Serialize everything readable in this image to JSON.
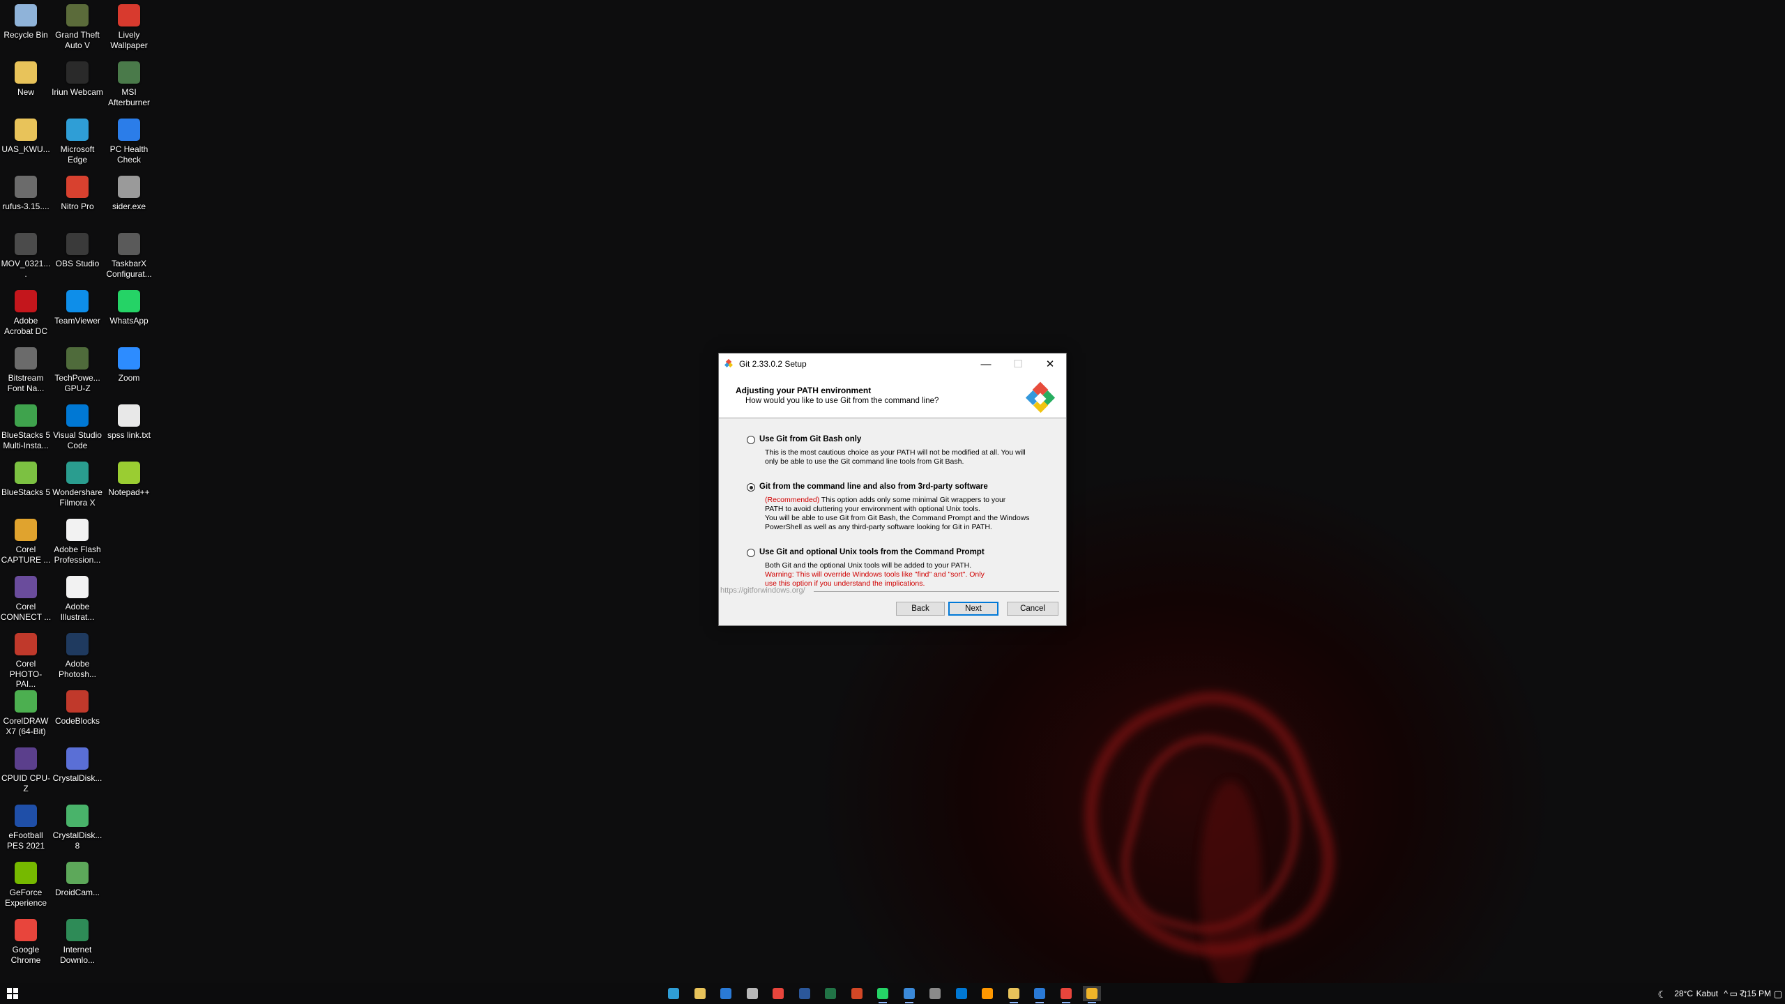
{
  "desktop": {
    "icons": [
      {
        "label": "Recycle Bin",
        "icon": "recycle-bin-icon",
        "color": "#8fb3d9"
      },
      {
        "label": "Grand Theft Auto V",
        "icon": "gta-icon",
        "color": "#5b6b3a"
      },
      {
        "label": "Lively Wallpaper",
        "icon": "lively-icon",
        "color": "#d83a2e"
      },
      {
        "label": "New",
        "icon": "folder-icon",
        "color": "#e8c35a"
      },
      {
        "label": "Iriun Webcam",
        "icon": "webcam-icon",
        "color": "#2a2a2a"
      },
      {
        "label": "MSI Afterburner",
        "icon": "afterburner-icon",
        "color": "#4a7a4a"
      },
      {
        "label": "UAS_KWU...",
        "icon": "folder-icon",
        "color": "#e8c35a"
      },
      {
        "label": "Microsoft Edge",
        "icon": "edge-icon",
        "color": "#2f9ed6"
      },
      {
        "label": "PC Health Check",
        "icon": "health-icon",
        "color": "#2b7de9"
      },
      {
        "label": "rufus-3.15....",
        "icon": "usb-icon",
        "color": "#6b6b6b"
      },
      {
        "label": "Nitro Pro",
        "icon": "nitro-icon",
        "color": "#d8412f"
      },
      {
        "label": "sider.exe",
        "icon": "exe-icon",
        "color": "#9a9a9a"
      },
      {
        "label": "MOV_0321....",
        "icon": "video-icon",
        "color": "#4b4b4b"
      },
      {
        "label": "OBS Studio",
        "icon": "obs-icon",
        "color": "#3a3a3a"
      },
      {
        "label": "TaskbarX Configurat...",
        "icon": "taskbarx-icon",
        "color": "#5a5a5a"
      },
      {
        "label": "Adobe Acrobat DC",
        "icon": "acrobat-icon",
        "color": "#c4161c"
      },
      {
        "label": "TeamViewer",
        "icon": "teamviewer-icon",
        "color": "#0e8ee9"
      },
      {
        "label": "WhatsApp",
        "icon": "whatsapp-icon",
        "color": "#25d366"
      },
      {
        "label": "Bitstream Font Na...",
        "icon": "font-icon",
        "color": "#6b6b6b"
      },
      {
        "label": "TechPowe... GPU-Z",
        "icon": "gpuz-icon",
        "color": "#4f6b3b"
      },
      {
        "label": "Zoom",
        "icon": "zoom-icon",
        "color": "#2d8cff"
      },
      {
        "label": "BlueStacks 5 Multi-Insta...",
        "icon": "bluestacks-multi-icon",
        "color": "#3fa34d"
      },
      {
        "label": "Visual Studio Code",
        "icon": "vscode-icon",
        "color": "#0078d4"
      },
      {
        "label": "spss link.txt",
        "icon": "text-file-icon",
        "color": "#e8e8e8"
      },
      {
        "label": "BlueStacks 5",
        "icon": "bluestacks-icon",
        "color": "#7cc142"
      },
      {
        "label": "Wondershare Filmora X",
        "icon": "filmora-icon",
        "color": "#2a9d8f"
      },
      {
        "label": "Notepad++",
        "icon": "notepadpp-icon",
        "color": "#9acd32"
      },
      {
        "label": "Corel CAPTURE ...",
        "icon": "corel-capture-icon",
        "color": "#e0a32e"
      },
      {
        "label": "Adobe Flash Profession...",
        "icon": "file-icon",
        "color": "#f2f2f2"
      },
      {
        "label": "Corel CONNECT ...",
        "icon": "corel-connect-icon",
        "color": "#6a4c9c"
      },
      {
        "label": "Adobe Illustrat...",
        "icon": "file-icon",
        "color": "#f2f2f2"
      },
      {
        "label": "Corel PHOTO-PAI...",
        "icon": "corel-photopaint-icon",
        "color": "#c0392b"
      },
      {
        "label": "Adobe Photosh...",
        "icon": "photoshop-icon",
        "color": "#1f3a5f"
      },
      {
        "label": "CorelDRAW X7 (64-Bit)",
        "icon": "coreldraw-icon",
        "color": "#4caf50"
      },
      {
        "label": "CodeBlocks",
        "icon": "codeblocks-icon",
        "color": "#c0392b"
      },
      {
        "label": "CPUID CPU-Z",
        "icon": "cpuz-icon",
        "color": "#5b3f8c"
      },
      {
        "label": "CrystalDisk...",
        "icon": "crystaldisk-icon",
        "color": "#5a6fd6"
      },
      {
        "label": "eFootball PES 2021",
        "icon": "pes-icon",
        "color": "#1f4fa8"
      },
      {
        "label": "CrystalDisk... 8",
        "icon": "crystaldisk-icon",
        "color": "#49b36a"
      },
      {
        "label": "GeForce Experience",
        "icon": "geforce-icon",
        "color": "#76b900"
      },
      {
        "label": "DroidCam...",
        "icon": "droidcam-icon",
        "color": "#5da85a"
      },
      {
        "label": "Google Chrome",
        "icon": "chrome-icon",
        "color": "#e8453c"
      },
      {
        "label": "Internet Downlo...",
        "icon": "idm-icon",
        "color": "#2e8b57"
      }
    ]
  },
  "dialog": {
    "title": "Git 2.33.0.2 Setup",
    "minimize_glyph": "—",
    "maximize_glyph": "☐",
    "close_glyph": "✕",
    "header_title": "Adjusting your PATH environment",
    "header_subtitle": "How would you like to use Git from the command line?",
    "options": [
      {
        "label": "Use Git from Git Bash only",
        "selected": false,
        "desc_lines": [
          "This is the most cautious choice as your PATH will not be modified at all. You will",
          "only be able to use the Git command line tools from Git Bash."
        ]
      },
      {
        "label": "Git from the command line and also from 3rd-party software",
        "selected": true,
        "recommended_tag": "(Recommended)",
        "desc_first_rest": " This option adds only some minimal Git wrappers to your",
        "desc_lines": [
          "PATH to avoid cluttering your environment with optional Unix tools.",
          "You will be able to use Git from Git Bash, the Command Prompt and the Windows",
          "PowerShell as well as any third-party software looking for Git in PATH."
        ]
      },
      {
        "label": "Use Git and optional Unix tools from the Command Prompt",
        "selected": false,
        "desc_lines": [
          "Both Git and the optional Unix tools will be added to your PATH."
        ],
        "warning_lines": [
          "Warning: This will override Windows tools like \"find\" and \"sort\". Only",
          "use this option if you understand the implications."
        ]
      }
    ],
    "footer_url": "https://gitforwindows.org/",
    "buttons": {
      "back": "Back",
      "next": "Next",
      "cancel": "Cancel"
    }
  },
  "taskbar": {
    "apps": [
      {
        "name": "taskbar-edge",
        "icon": "edge-icon",
        "color": "#2f9ed6",
        "running": false
      },
      {
        "name": "taskbar-file-explorer",
        "icon": "folder-icon",
        "color": "#e8c35a",
        "running": false
      },
      {
        "name": "taskbar-mail",
        "icon": "mail-icon",
        "color": "#2a7ad6",
        "running": false
      },
      {
        "name": "taskbar-store",
        "icon": "store-icon",
        "color": "#b8b8b8",
        "running": false
      },
      {
        "name": "taskbar-chrome",
        "icon": "chrome-icon",
        "color": "#e8453c",
        "running": false
      },
      {
        "name": "taskbar-word",
        "icon": "word-icon",
        "color": "#2b579a",
        "running": false
      },
      {
        "name": "taskbar-excel",
        "icon": "excel-icon",
        "color": "#217346",
        "running": false
      },
      {
        "name": "taskbar-powerpoint",
        "icon": "powerpoint-icon",
        "color": "#d24726",
        "running": false
      },
      {
        "name": "taskbar-whatsapp",
        "icon": "whatsapp-icon",
        "color": "#25d366",
        "running": true
      },
      {
        "name": "taskbar-mail-2",
        "icon": "mail-icon",
        "color": "#3b8ad9",
        "running": true
      },
      {
        "name": "taskbar-settings",
        "icon": "gear-icon",
        "color": "#8a8a8a",
        "running": false
      },
      {
        "name": "taskbar-vscode",
        "icon": "vscode-icon",
        "color": "#0078d4",
        "running": false
      },
      {
        "name": "taskbar-sublime",
        "icon": "sublime-icon",
        "color": "#ff9800",
        "running": false
      },
      {
        "name": "taskbar-explorer",
        "icon": "folder-icon",
        "color": "#e8c35a",
        "running": true
      },
      {
        "name": "taskbar-remote",
        "icon": "remote-icon",
        "color": "#2a7ad6",
        "running": true
      },
      {
        "name": "taskbar-chrome-2",
        "icon": "chrome-icon",
        "color": "#e8453c",
        "running": true
      },
      {
        "name": "taskbar-git-setup",
        "icon": "git-icon",
        "color": "#f0b429",
        "running": true
      }
    ],
    "weather_temp": "28°C",
    "weather_text": "Kabut",
    "time": "7:15 PM"
  }
}
